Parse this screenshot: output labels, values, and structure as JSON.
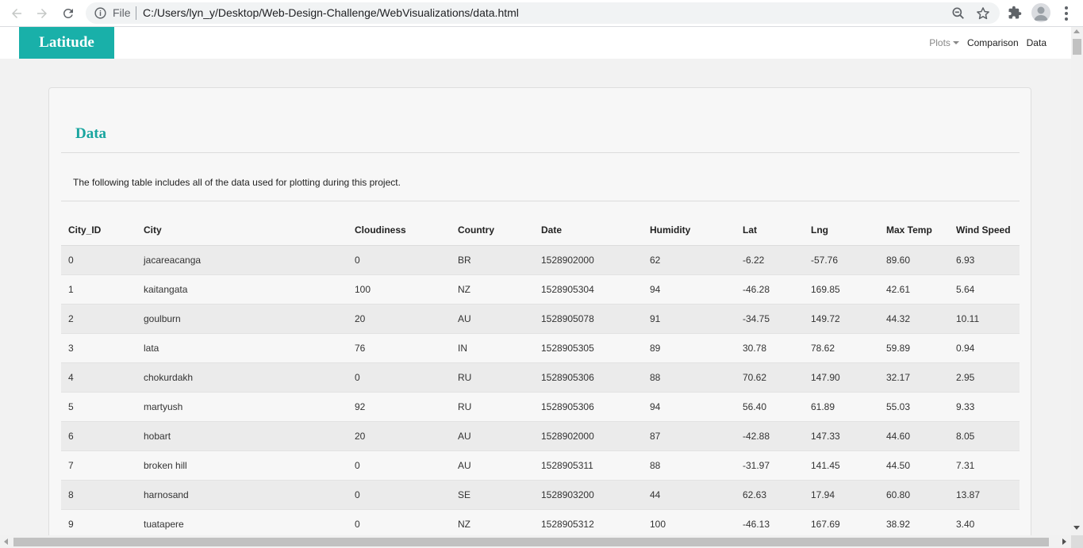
{
  "browser": {
    "file_label": "File",
    "url": "C:/Users/lyn_y/Desktop/Web-Design-Challenge/WebVisualizations/data.html"
  },
  "navbar": {
    "brand": "Latitude",
    "links": {
      "plots": "Plots",
      "comparison": "Comparison",
      "data": "Data"
    }
  },
  "panel": {
    "title": "Data",
    "description": "The following table includes all of the data used for plotting during this project."
  },
  "table": {
    "headers": [
      "City_ID",
      "City",
      "Cloudiness",
      "Country",
      "Date",
      "Humidity",
      "Lat",
      "Lng",
      "Max Temp",
      "Wind Speed"
    ],
    "rows": [
      [
        "0",
        "jacareacanga",
        "0",
        "BR",
        "1528902000",
        "62",
        "-6.22",
        "-57.76",
        "89.60",
        "6.93"
      ],
      [
        "1",
        "kaitangata",
        "100",
        "NZ",
        "1528905304",
        "94",
        "-46.28",
        "169.85",
        "42.61",
        "5.64"
      ],
      [
        "2",
        "goulburn",
        "20",
        "AU",
        "1528905078",
        "91",
        "-34.75",
        "149.72",
        "44.32",
        "10.11"
      ],
      [
        "3",
        "lata",
        "76",
        "IN",
        "1528905305",
        "89",
        "30.78",
        "78.62",
        "59.89",
        "0.94"
      ],
      [
        "4",
        "chokurdakh",
        "0",
        "RU",
        "1528905306",
        "88",
        "70.62",
        "147.90",
        "32.17",
        "2.95"
      ],
      [
        "5",
        "martyush",
        "92",
        "RU",
        "1528905306",
        "94",
        "56.40",
        "61.89",
        "55.03",
        "9.33"
      ],
      [
        "6",
        "hobart",
        "20",
        "AU",
        "1528902000",
        "87",
        "-42.88",
        "147.33",
        "44.60",
        "8.05"
      ],
      [
        "7",
        "broken hill",
        "0",
        "AU",
        "1528905311",
        "88",
        "-31.97",
        "141.45",
        "44.50",
        "7.31"
      ],
      [
        "8",
        "harnosand",
        "0",
        "SE",
        "1528903200",
        "44",
        "62.63",
        "17.94",
        "60.80",
        "13.87"
      ],
      [
        "9",
        "tuatapere",
        "0",
        "NZ",
        "1528905312",
        "100",
        "-46.13",
        "167.69",
        "38.92",
        "3.40"
      ]
    ]
  },
  "colors": {
    "brand": "#19b0a9",
    "title": "#19a59f"
  },
  "icons": {
    "back": "arrow-left-icon",
    "forward": "arrow-right-icon",
    "reload": "reload-icon",
    "info": "info-icon",
    "zoom": "zoom-icon",
    "bookmark": "star-icon",
    "extensions": "puzzle-icon",
    "profile": "avatar-icon",
    "menu": "kebab-menu-icon"
  }
}
